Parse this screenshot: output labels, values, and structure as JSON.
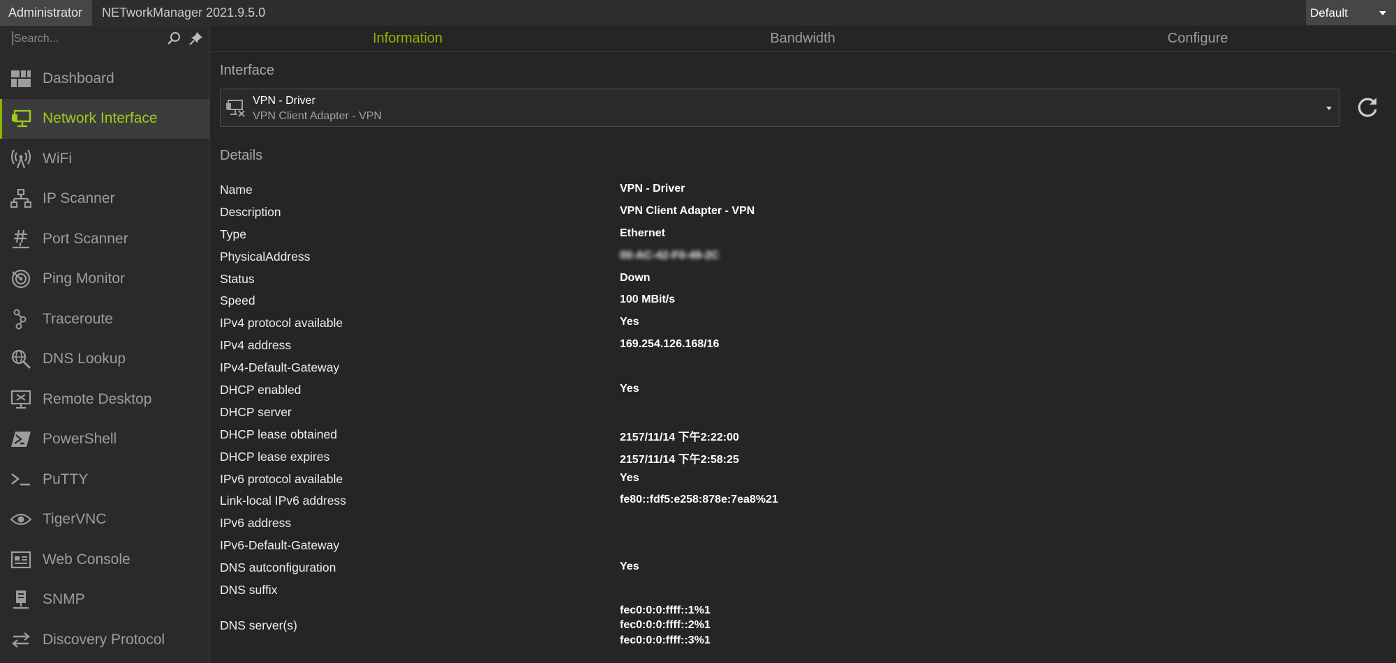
{
  "titlebar": {
    "user": "Administrator",
    "title": "NETworkManager 2021.9.5.0",
    "profile": "Default"
  },
  "sidebar": {
    "search_placeholder": "Search...",
    "items": [
      {
        "label": "Dashboard",
        "icon": "dashboard-icon"
      },
      {
        "label": "Network Interface",
        "icon": "network-interface-icon",
        "active": true
      },
      {
        "label": "WiFi",
        "icon": "wifi-icon"
      },
      {
        "label": "IP Scanner",
        "icon": "ip-scanner-icon"
      },
      {
        "label": "Port Scanner",
        "icon": "port-scanner-icon"
      },
      {
        "label": "Ping Monitor",
        "icon": "ping-monitor-icon"
      },
      {
        "label": "Traceroute",
        "icon": "traceroute-icon"
      },
      {
        "label": "DNS Lookup",
        "icon": "dns-lookup-icon"
      },
      {
        "label": "Remote Desktop",
        "icon": "remote-desktop-icon"
      },
      {
        "label": "PowerShell",
        "icon": "powershell-icon"
      },
      {
        "label": "PuTTY",
        "icon": "putty-icon"
      },
      {
        "label": "TigerVNC",
        "icon": "tigervnc-icon"
      },
      {
        "label": "Web Console",
        "icon": "web-console-icon"
      },
      {
        "label": "SNMP",
        "icon": "snmp-icon"
      },
      {
        "label": "Discovery Protocol",
        "icon": "discovery-protocol-icon"
      }
    ]
  },
  "tabs": [
    {
      "label": "Information",
      "active": true
    },
    {
      "label": "Bandwidth"
    },
    {
      "label": "Configure"
    }
  ],
  "interface": {
    "section_title": "Interface",
    "selected_name": "VPN - Driver",
    "selected_description": "VPN Client Adapter - VPN"
  },
  "details": {
    "section_title": "Details",
    "rows": [
      {
        "key": "Name",
        "value": "VPN - Driver"
      },
      {
        "key": "Description",
        "value": "VPN Client Adapter - VPN"
      },
      {
        "key": "Type",
        "value": "Ethernet"
      },
      {
        "key": "PhysicalAddress",
        "value": "00-AC-42-F0-49-2C",
        "blurred": true
      },
      {
        "key": "Status",
        "value": "Down"
      },
      {
        "key": "Speed",
        "value": "100 MBit/s"
      },
      {
        "key": "IPv4 protocol available",
        "value": "Yes"
      },
      {
        "key": "IPv4 address",
        "value": "169.254.126.168/16"
      },
      {
        "key": "IPv4-Default-Gateway",
        "value": ""
      },
      {
        "key": "DHCP enabled",
        "value": "Yes"
      },
      {
        "key": "DHCP server",
        "value": ""
      },
      {
        "key": "DHCP lease obtained",
        "value": "2157/11/14 下午2:22:00"
      },
      {
        "key": "DHCP lease expires",
        "value": "2157/11/14 下午2:58:25"
      },
      {
        "key": "IPv6 protocol available",
        "value": "Yes"
      },
      {
        "key": "Link-local IPv6 address",
        "value": "fe80::fdf5:e258:878e:7ea8%21"
      },
      {
        "key": "IPv6 address",
        "value": ""
      },
      {
        "key": "IPv6-Default-Gateway",
        "value": ""
      },
      {
        "key": "DNS autconfiguration",
        "value": "Yes"
      },
      {
        "key": "DNS suffix",
        "value": ""
      }
    ],
    "dns_servers_key": "DNS server(s)",
    "dns_servers": [
      "fec0:0:0:ffff::1%1",
      "fec0:0:0:ffff::2%1",
      "fec0:0:0:ffff::3%1"
    ]
  },
  "colors": {
    "accent": "#8db600",
    "background": "#252525",
    "sidebar": "#2a2a2a",
    "active_item": "#3c3c3c"
  }
}
